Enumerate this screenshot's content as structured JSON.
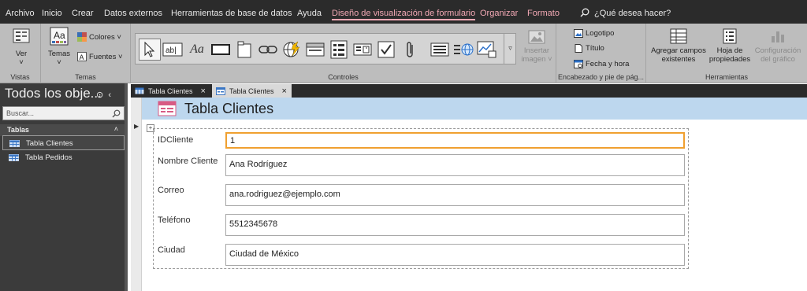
{
  "menu": {
    "items": [
      "Archivo",
      "Inicio",
      "Crear",
      "Datos externos",
      "Herramientas de base de datos",
      "Ayuda",
      "Diseño de visualización de formulario",
      "Organizar",
      "Formato"
    ],
    "tell_me": "¿Qué desea hacer?"
  },
  "ribbon": {
    "vistas": {
      "ver_label": "Ver",
      "group_label": "Vistas"
    },
    "temas": {
      "temas_label": "Temas",
      "colores_label": "Colores",
      "fuentes_label": "Fuentes",
      "group_label": "Temas"
    },
    "controles": {
      "group_label": "Controles",
      "insertar_imagen_line1": "Insertar",
      "insertar_imagen_line2": "imagen"
    },
    "encabezado": {
      "logotipo": "Logotipo",
      "titulo": "Título",
      "fecha_hora": "Fecha y hora",
      "group_label": "Encabezado y pie de pág..."
    },
    "herramientas": {
      "agregar_line1": "Agregar campos",
      "agregar_line2": "existentes",
      "hoja_line1": "Hoja de",
      "hoja_line2": "propiedades",
      "config_line1": "Configuración",
      "config_line2": "del gráfico",
      "group_label": "Herramientas"
    }
  },
  "tabs": [
    {
      "label": "Tabla Clientes"
    },
    {
      "label": "Tabla Clientes"
    }
  ],
  "nav": {
    "title": "Todos los obje...",
    "search_placeholder": "Buscar...",
    "group_label": "Tablas",
    "items": [
      {
        "label": "Tabla Clientes"
      },
      {
        "label": "Tabla Pedidos"
      }
    ]
  },
  "form": {
    "title": "Tabla Clientes",
    "fields": [
      {
        "label": "IDCliente",
        "value": "1"
      },
      {
        "label": "Nombre Cliente",
        "value": "Ana Rodríguez"
      },
      {
        "label": "Correo",
        "value": "ana.rodriguez@ejemplo.com"
      },
      {
        "label": "Teléfono",
        "value": "5512345678"
      },
      {
        "label": "Ciudad",
        "value": "Ciudad de México"
      }
    ]
  },
  "colors": {
    "accent": "#f2a8b4",
    "ribbon_bg": "#bdbdbd",
    "header_bg": "#bdd7ee",
    "focus_border": "#f0a030",
    "dark_bg": "#2b2b2b"
  }
}
